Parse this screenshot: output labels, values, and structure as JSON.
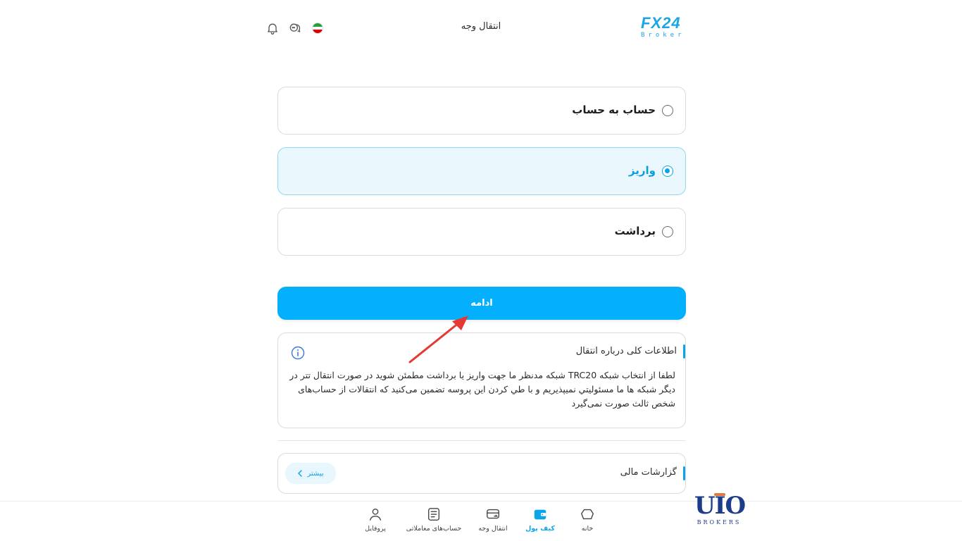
{
  "header": {
    "logo_top": "FX24",
    "logo_bottom": "Broker",
    "title": "انتقال وجه",
    "icons": [
      "bell-icon",
      "chat-icon",
      "iran-flag-icon"
    ]
  },
  "options": [
    {
      "label": "حساب به حساب",
      "selected": false
    },
    {
      "label": "واریز",
      "selected": true
    },
    {
      "label": "برداشت",
      "selected": false
    }
  ],
  "continue_label": "ادامه",
  "info": {
    "title": "اطلاعات کلی درباره انتقال",
    "text": "لطفا از انتخاب شبکه TRC20 شبکه مدنظر ما جهت واریز یا برداشت مطمئن شوید در صورت انتقال تتر در دیگر شبکه ها ما مسئولیتي نمیپذیریم و با طي کردن این پروسه تضمین می‌کنید که انتقالات از حساب‌های شخص ثالث صورت نمی‌گیرد"
  },
  "reports": {
    "title": "گزارشات مالی",
    "more_label": "بیشتر"
  },
  "bottom_nav": [
    {
      "label": "خانه",
      "icon": "home-icon",
      "active": false
    },
    {
      "label": "کیف پول",
      "icon": "wallet-icon",
      "active": true
    },
    {
      "label": "انتقال وجه",
      "icon": "transfer-icon",
      "active": false
    },
    {
      "label": "حساب‌های معاملاتی",
      "icon": "trading-accounts-icon",
      "active": false
    },
    {
      "label": "پروفایل",
      "icon": "profile-icon",
      "active": false
    }
  ],
  "watermark": {
    "mark": "UIO",
    "sub": "BROKERS"
  },
  "colors": {
    "accent": "#04b0fb",
    "selected_bg": "#eaf8fd",
    "annotation_arrow": "#e53935"
  }
}
